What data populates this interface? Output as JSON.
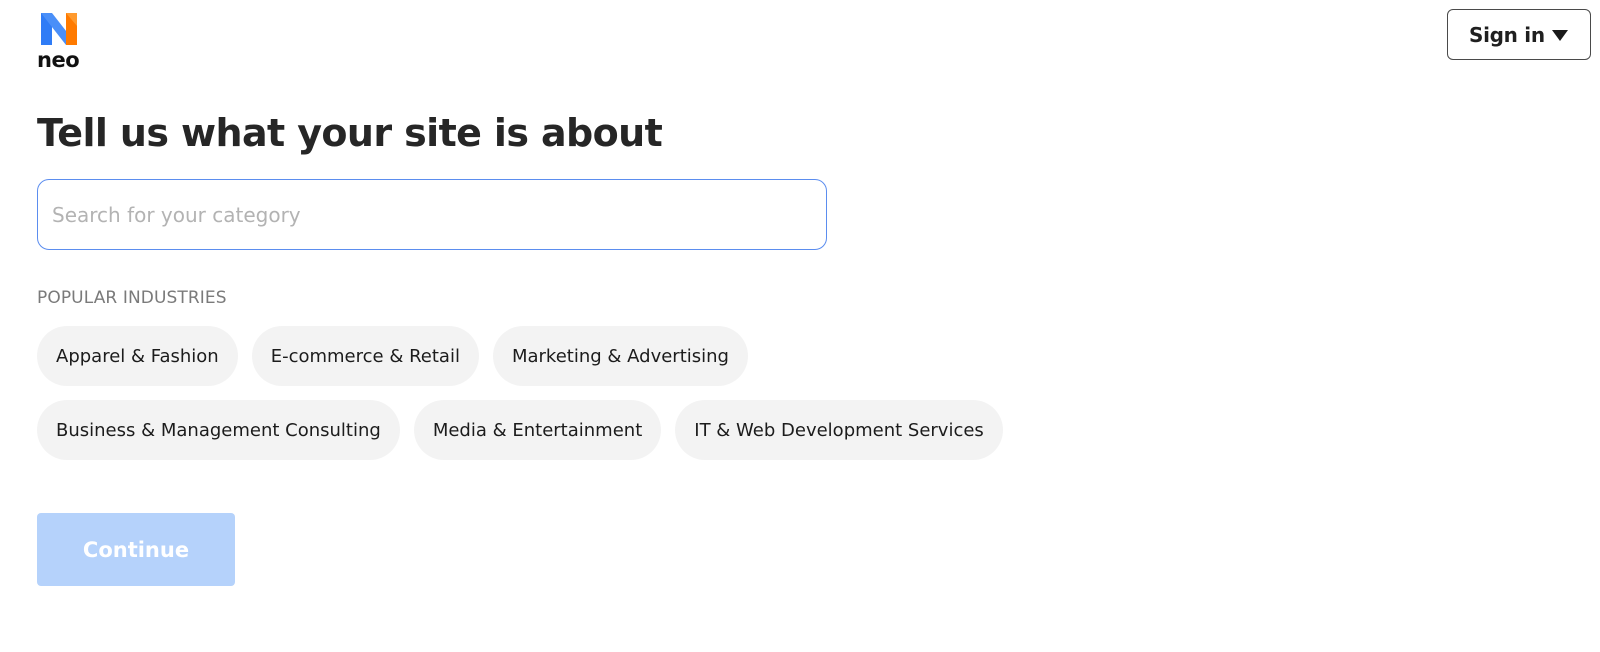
{
  "brand": {
    "name": "neo",
    "colors": {
      "blue": "#2f7cf6",
      "orange": "#ff7a00"
    }
  },
  "header": {
    "signin_label": "Sign in",
    "signin_icon": "caret-down-icon"
  },
  "main": {
    "title": "Tell us what your site is about",
    "search": {
      "placeholder": "Search for your category",
      "value": ""
    },
    "popular": {
      "label": "POPULAR INDUSTRIES",
      "items": [
        "Apparel & Fashion",
        "E-commerce & Retail",
        "Marketing & Advertising",
        "Business & Management Consulting",
        "Media & Entertainment",
        "IT & Web Development Services"
      ]
    },
    "continue_label": "Continue",
    "continue_disabled": true
  },
  "colors": {
    "search_border": "#5b8def",
    "chip_background": "#f3f3f3",
    "continue_background": "#b5d2fb"
  }
}
